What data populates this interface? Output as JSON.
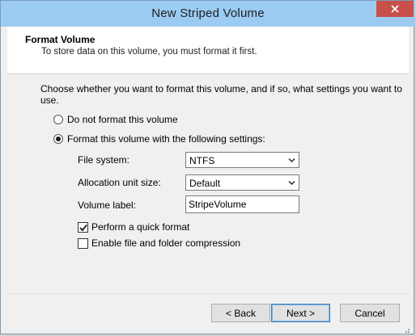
{
  "window": {
    "title": "New Striped Volume",
    "close_glyph": "✕"
  },
  "header": {
    "title": "Format Volume",
    "subtitle": "To store data on this volume, you must format it first."
  },
  "instruction": "Choose whether you want to format this volume, and if so, what settings you want to use.",
  "options": {
    "no_format_label": "Do not format this volume",
    "no_format_selected": false,
    "format_label": "Format this volume with the following settings:",
    "format_selected": true
  },
  "settings": {
    "file_system_label": "File system:",
    "file_system_value": "NTFS",
    "allocation_label": "Allocation unit size:",
    "allocation_value": "Default",
    "volume_label_label": "Volume label:",
    "volume_label_value": "StripeVolume",
    "quick_format_label": "Perform a quick format",
    "quick_format_checked": true,
    "compression_label": "Enable file and folder compression",
    "compression_checked": false
  },
  "buttons": {
    "back": "< Back",
    "next": "Next >",
    "cancel": "Cancel"
  },
  "colors": {
    "titlebar": "#9ccbf2",
    "close_button": "#c7504a",
    "default_button_border": "#3c7fb1"
  },
  "icons": [
    "close-icon",
    "dropdown-arrow-icon",
    "checkmark-icon",
    "resize-grip-icon"
  ]
}
